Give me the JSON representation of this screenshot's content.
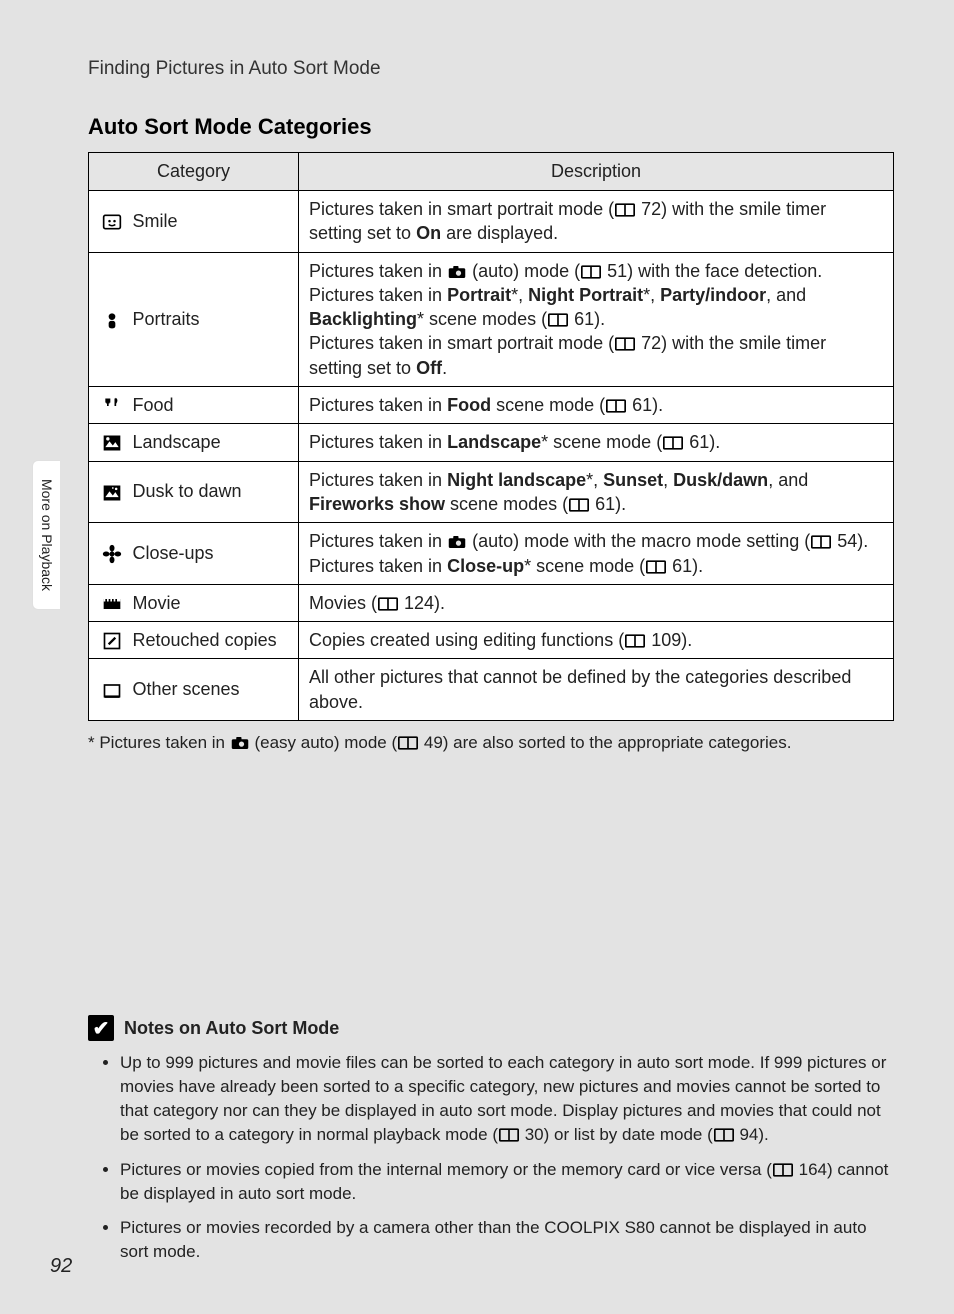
{
  "breadcrumb": "Finding Pictures in Auto Sort Mode",
  "section_title": "Auto Sort Mode Categories",
  "side_tab": "More on Playback",
  "page_number": "92",
  "table": {
    "headers": {
      "category": "Category",
      "description": "Description"
    },
    "rows": [
      {
        "icon_name": "smile-icon",
        "category": "Smile",
        "description_parts": [
          {
            "t": "Pictures taken in smart portrait mode ("
          },
          {
            "ref": true
          },
          {
            "t": " 72) with the smile timer setting set to "
          },
          {
            "b": "On"
          },
          {
            "t": " are displayed."
          }
        ]
      },
      {
        "icon_name": "portrait-icon",
        "category": "Portraits",
        "description_parts": [
          {
            "t": "Pictures taken in "
          },
          {
            "cam": true
          },
          {
            "t": " (auto) mode ("
          },
          {
            "ref": true
          },
          {
            "t": " 51) with the face detection. Pictures taken in "
          },
          {
            "b": "Portrait"
          },
          {
            "t": "*, "
          },
          {
            "b": "Night Portrait"
          },
          {
            "t": "*, "
          },
          {
            "b": "Party/indoor"
          },
          {
            "t": ", and "
          },
          {
            "b": "Backlighting"
          },
          {
            "t": "* scene modes ("
          },
          {
            "ref": true
          },
          {
            "t": " 61)."
          },
          {
            "br": true
          },
          {
            "t": "Pictures taken in smart portrait mode ("
          },
          {
            "ref": true
          },
          {
            "t": " 72) with the smile timer setting set to "
          },
          {
            "b": "Off"
          },
          {
            "t": "."
          }
        ]
      },
      {
        "icon_name": "food-icon",
        "category": "Food",
        "description_parts": [
          {
            "t": "Pictures taken in "
          },
          {
            "b": "Food"
          },
          {
            "t": " scene mode ("
          },
          {
            "ref": true
          },
          {
            "t": " 61)."
          }
        ]
      },
      {
        "icon_name": "landscape-icon",
        "category": "Landscape",
        "description_parts": [
          {
            "t": "Pictures taken in "
          },
          {
            "b": "Landscape"
          },
          {
            "t": "* scene mode ("
          },
          {
            "ref": true
          },
          {
            "t": " 61)."
          }
        ]
      },
      {
        "icon_name": "dusk-icon",
        "category": "Dusk to dawn",
        "description_parts": [
          {
            "t": "Pictures taken in "
          },
          {
            "b": "Night landscape"
          },
          {
            "t": "*, "
          },
          {
            "b": "Sunset"
          },
          {
            "t": ", "
          },
          {
            "b": "Dusk/dawn"
          },
          {
            "t": ", and "
          },
          {
            "b": "Fireworks show"
          },
          {
            "t": " scene modes ("
          },
          {
            "ref": true
          },
          {
            "t": " 61)."
          }
        ]
      },
      {
        "icon_name": "closeup-icon",
        "category": "Close-ups",
        "description_parts": [
          {
            "t": "Pictures taken in "
          },
          {
            "cam": true
          },
          {
            "t": " (auto) mode with the macro mode setting ("
          },
          {
            "ref": true
          },
          {
            "t": " 54)."
          },
          {
            "br": true
          },
          {
            "t": "Pictures taken in "
          },
          {
            "b": "Close-up"
          },
          {
            "t": "* scene mode ("
          },
          {
            "ref": true
          },
          {
            "t": " 61)."
          }
        ]
      },
      {
        "icon_name": "movie-icon",
        "category": "Movie",
        "description_parts": [
          {
            "t": "Movies ("
          },
          {
            "ref": true
          },
          {
            "t": " 124)."
          }
        ]
      },
      {
        "icon_name": "retouch-icon",
        "category": "Retouched copies",
        "description_parts": [
          {
            "t": "Copies created using editing functions ("
          },
          {
            "ref": true
          },
          {
            "t": " 109)."
          }
        ]
      },
      {
        "icon_name": "other-icon",
        "category": "Other scenes",
        "description_parts": [
          {
            "t": "All other pictures that cannot be defined by the categories described above."
          }
        ]
      }
    ]
  },
  "footnote_parts": [
    {
      "t": "*  Pictures taken in "
    },
    {
      "cam": true
    },
    {
      "t": " (easy auto) mode ("
    },
    {
      "ref": true
    },
    {
      "t": " 49) are also sorted to the appropriate categories."
    }
  ],
  "notes": {
    "heading": "Notes on Auto Sort Mode",
    "items": [
      [
        {
          "t": "Up to 999 pictures and movie files can be sorted to each category in auto sort mode. If 999 pictures or movies have already been sorted to a specific category, new pictures and movies cannot be sorted to that category nor can they be displayed in auto sort mode. Display pictures and movies that could not be sorted to a category in normal playback mode ("
        },
        {
          "ref": true
        },
        {
          "t": " 30) or list by date mode ("
        },
        {
          "ref": true
        },
        {
          "t": " 94)."
        }
      ],
      [
        {
          "t": "Pictures or movies copied from the internal memory or the memory card or vice versa ("
        },
        {
          "ref": true
        },
        {
          "t": " 164) cannot be displayed in auto sort mode."
        }
      ],
      [
        {
          "t": "Pictures or movies recorded by a camera other than the COOLPIX S80 cannot be displayed in auto sort mode."
        }
      ]
    ]
  }
}
